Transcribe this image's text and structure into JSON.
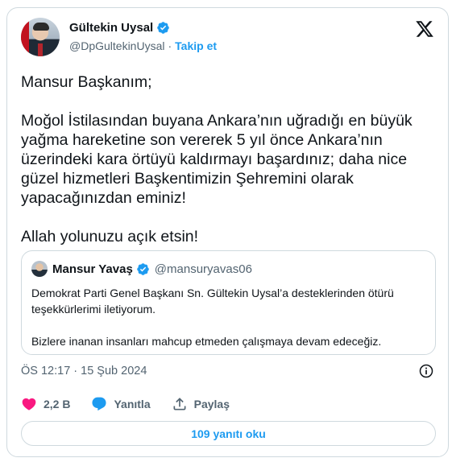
{
  "author": {
    "name": "Gültekin Uysal",
    "handle": "@DpGultekinUysal",
    "separator": "·",
    "follow_label": "Takip et"
  },
  "tweet": {
    "text": "Mansur Başkanım;\n\nMoğol İstilasından buyana Ankara’nın uğradığı en büyük yağma hareketine son vererek 5 yıl önce Ankara’nın üzerindeki kara örtüyü kaldırmayı başardınız; daha nice güzel hizmetleri Başkentimizin Şehremini olarak yapacağınızdan eminiz!\n\nAllah yolunuzu açık etsin!"
  },
  "quote": {
    "name": "Mansur Yavaş",
    "handle": "@mansuryavas06",
    "text": "Demokrat Parti Genel Başkanı Sn. Gültekin Uysal’a desteklerinden ötürü teşekkürlerimi iletiyorum.\n\nBizlere inanan insanları mahcup etmeden çalışmaya devam edeceğiz."
  },
  "timestamp": "ÖS 12:17 · 15 Şub 2024",
  "actions": {
    "like_count": "2,2 B",
    "reply_label": "Yanıtla",
    "share_label": "Paylaş"
  },
  "replies_button": "109 yanıtı oku",
  "colors": {
    "accent": "#1d9bf0",
    "like": "#f91880",
    "muted": "#536471",
    "border": "#cfd9de"
  },
  "icons": [
    "verified-badge-icon",
    "x-logo-icon",
    "info-icon",
    "heart-icon",
    "reply-bubble-icon",
    "share-icon"
  ]
}
